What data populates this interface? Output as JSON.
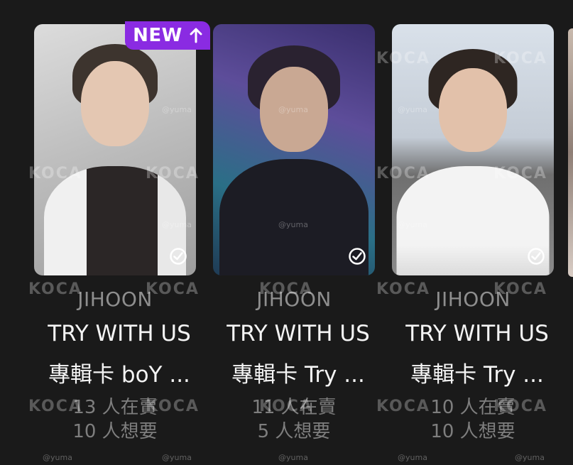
{
  "cards": [
    {
      "badge": {
        "label": "NEW",
        "icon": "arrow-up-icon"
      },
      "member": "JIHOON",
      "title_line1": "TRY WITH US",
      "title_line2": "專輯卡 boY ...",
      "selling": "13 人在賣",
      "wanted": "10 人想要",
      "owned_icon": "check-circle-icon"
    },
    {
      "member": "JIHOON",
      "title_line1": "TRY WITH US",
      "title_line2": "專輯卡 Try ...",
      "selling": "11 人在賣",
      "wanted": "5 人想要",
      "owned_icon": "check-circle-icon"
    },
    {
      "member": "JIHOON",
      "title_line1": "TRY WITH US",
      "title_line2": "專輯卡 Try ...",
      "selling": "10 人在賣",
      "wanted": "10 人想要",
      "owned_icon": "check-circle-icon"
    }
  ],
  "watermarks": {
    "logo": "KOCA",
    "handle": "@yuma"
  },
  "colors": {
    "background": "#1a1a1a",
    "badge": "#8a2be2",
    "title": "#f4f4f4",
    "muted": "#8e8e8e"
  }
}
